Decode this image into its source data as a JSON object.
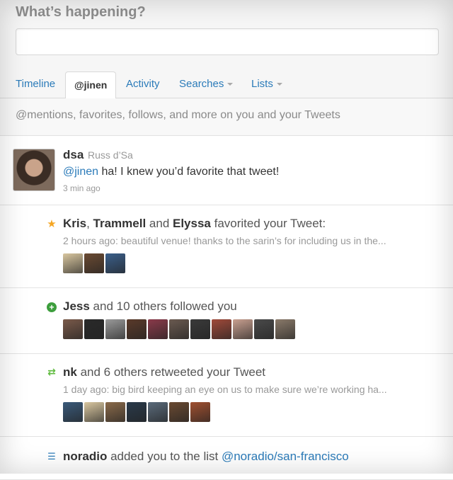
{
  "compose": {
    "title": "What’s happening?",
    "input_value": ""
  },
  "tabs": [
    {
      "label": "Timeline",
      "active": false
    },
    {
      "label": "@jinen",
      "active": true
    },
    {
      "label": "Activity",
      "active": false
    },
    {
      "label": "Searches",
      "active": false,
      "dropdown": true
    },
    {
      "label": "Lists",
      "active": false,
      "dropdown": true
    }
  ],
  "subheader": "@mentions, favorites, follows, and more on you and your Tweets",
  "tweet": {
    "username": "dsa",
    "fullname": "Russ d’Sa",
    "mention": "@jinen",
    "text": " ha! I knew you’d favorite that tweet!",
    "time": "3 min ago"
  },
  "favorited": {
    "icon": "star-icon",
    "name1": "Kris",
    "sep1": ", ",
    "name2": "Trammell",
    "sep2": " and ",
    "name3": "Elyssa",
    "action": " favorited your Tweet:",
    "snippet": "2 hours ago: beautiful venue! thanks to the sarin’s for including us in the...",
    "avatar_colors": [
      "#d9c7a0",
      "#6a4a32",
      "#3b5f8a"
    ]
  },
  "followed": {
    "icon": "plus-circle-icon",
    "name": "Jess",
    "action": " and 10 others followed you",
    "avatar_colors": [
      "#7a5a4a",
      "#2a2a2a",
      "#9a9a9a",
      "#5a3a2a",
      "#8a3a4a",
      "#6a5a50",
      "#3a3a3a",
      "#a04a3a",
      "#c9a090",
      "#4a4a4a",
      "#8a7a6a"
    ]
  },
  "retweeted": {
    "icon": "retweet-icon",
    "name": "nk",
    "action": " and 6 others retweeted your Tweet",
    "snippet": "1 day ago: big bird keeping an eye on us to make sure we’re working ha...",
    "avatar_colors": [
      "#3a5a7a",
      "#d9c7a0",
      "#8a6a4a",
      "#2a3a4a",
      "#5a6a7a",
      "#6a4a32",
      "#a05030"
    ]
  },
  "listed": {
    "icon": "list-icon",
    "name": "noradio",
    "action": " added you to the list ",
    "list_link": "@noradio/san-francisco"
  },
  "colors": {
    "link": "#2b7bb9",
    "star": "#f5a623",
    "retweet": "#5fbb3f",
    "follow": "#3d9e3d"
  }
}
